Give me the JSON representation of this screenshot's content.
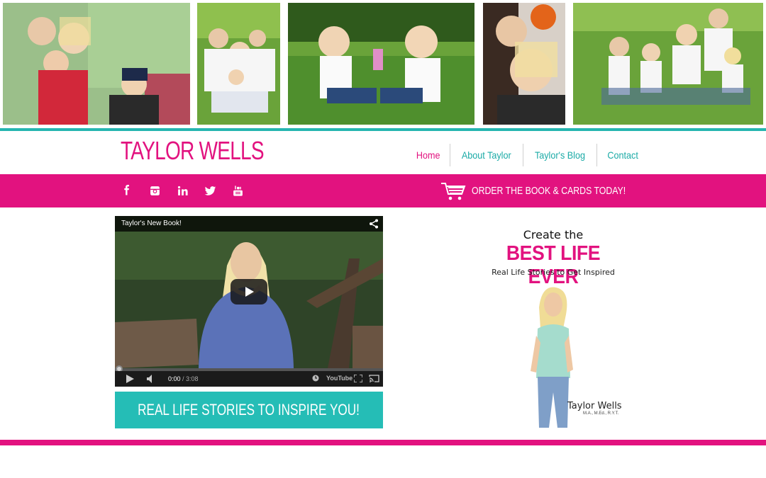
{
  "site": {
    "brand": "TAYLOR WELLS",
    "accent_pink": "#e2127f",
    "accent_teal": "#25b5b0"
  },
  "nav": {
    "items": [
      {
        "label": "Home",
        "active": true
      },
      {
        "label": "About Taylor",
        "active": false
      },
      {
        "label": "Taylor's Blog",
        "active": false
      },
      {
        "label": "Contact",
        "active": false
      }
    ]
  },
  "social": {
    "icons": [
      "facebook-icon",
      "instagram-icon",
      "linkedin-icon",
      "twitter-icon",
      "youtube-icon"
    ]
  },
  "order": {
    "label": "ORDER THE BOOK & CARDS TODAY!",
    "icon": "cart-icon"
  },
  "video": {
    "title": "Taylor's New Book!",
    "current_time": "0:00",
    "duration": "/ 3:08",
    "brand_label": "YouTube"
  },
  "banner": {
    "label": "REAL LIFE STORIES TO INSPIRE YOU!"
  },
  "book": {
    "create": "Create the",
    "title": "BEST LIFE EVER",
    "subtitle": "Real Life Stories to Get Inspired",
    "author": "Taylor Wells",
    "credentials": "M.A., M.Ed., R.Y.T."
  }
}
